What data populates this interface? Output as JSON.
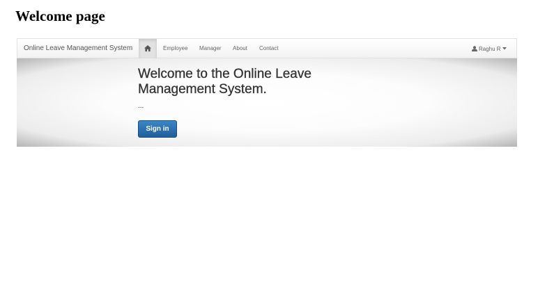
{
  "page": {
    "heading": "Welcome page"
  },
  "navbar": {
    "brand": "Online Leave Management System",
    "home_icon": "home-icon",
    "links": [
      "Employee",
      "Manager",
      "About",
      "Contact"
    ],
    "user": {
      "name": "Raghu R",
      "icon": "user-icon",
      "caret": "caret-down-icon"
    }
  },
  "hero": {
    "title": "Welcome to the Online Leave Management System.",
    "text": "...",
    "button_label": "Sign in"
  },
  "colors": {
    "button": "#2a6fad",
    "hero_background": "#f7f7f7",
    "navbar_background": "#f8f8f8"
  }
}
